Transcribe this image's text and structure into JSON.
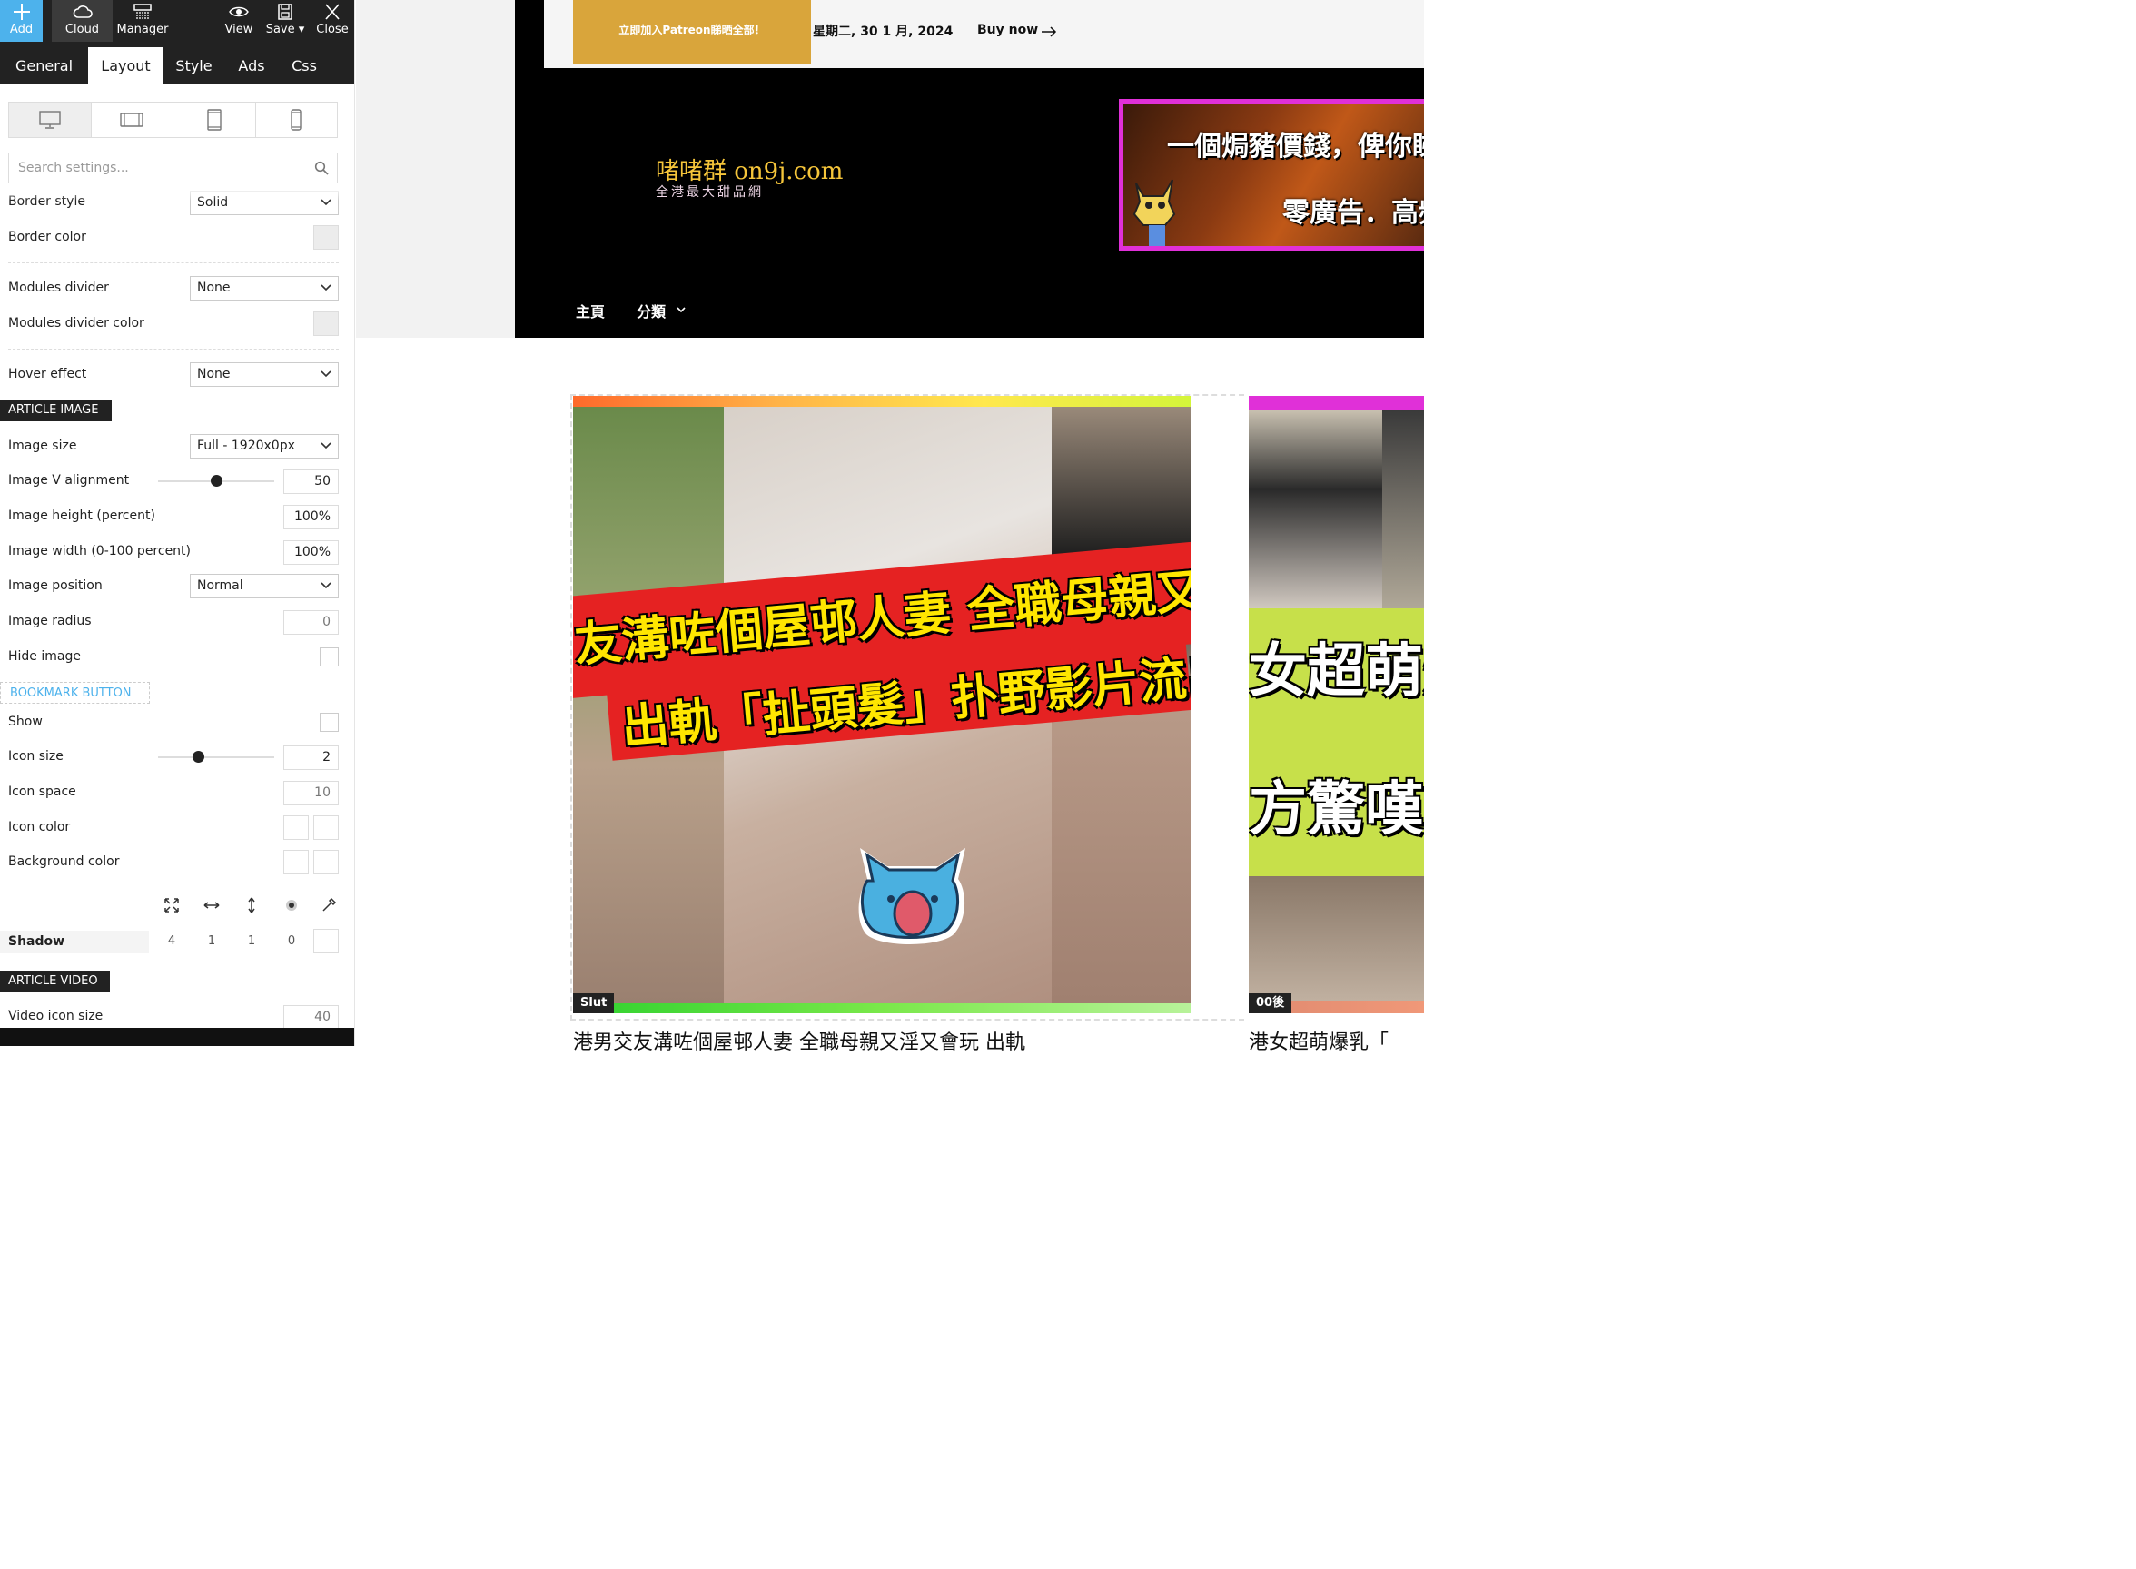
{
  "toolbar": {
    "add": "Add",
    "cloud": "Cloud",
    "manager": "Manager",
    "view": "View",
    "save": "Save",
    "close": "Close"
  },
  "tabs": [
    "General",
    "Layout",
    "Style",
    "Ads",
    "Css"
  ],
  "active_tab": "Layout",
  "search": {
    "placeholder": "Search settings..."
  },
  "settings": {
    "border_style": {
      "label": "Border style",
      "value": "Solid"
    },
    "border_color": {
      "label": "Border color"
    },
    "modules_divider": {
      "label": "Modules divider",
      "value": "None"
    },
    "modules_divider_color": {
      "label": "Modules divider color"
    },
    "hover_effect": {
      "label": "Hover effect",
      "value": "None"
    },
    "article_image_section": "ARTICLE IMAGE",
    "image_size": {
      "label": "Image size",
      "value": "Full - 1920x0px"
    },
    "image_v_alignment": {
      "label": "Image V alignment",
      "value": "50",
      "slider_fraction": 0.5
    },
    "image_height": {
      "label": "Image height (percent)",
      "value": "100%"
    },
    "image_width": {
      "label": "Image width (0-100 percent)",
      "value": "100%"
    },
    "image_position": {
      "label": "Image position",
      "value": "Normal"
    },
    "image_radius": {
      "label": "Image radius",
      "value": "0"
    },
    "hide_image": {
      "label": "Hide image"
    },
    "bookmark_section": "BOOKMARK BUTTON",
    "show": {
      "label": "Show"
    },
    "icon_size": {
      "label": "Icon size",
      "value": "2",
      "slider_fraction": 0.35
    },
    "icon_space": {
      "label": "Icon space",
      "value": "10"
    },
    "icon_color": {
      "label": "Icon color"
    },
    "background_color": {
      "label": "Background color"
    },
    "shadow": {
      "label": "Shadow",
      "values": [
        "4",
        "1",
        "1",
        "0"
      ]
    },
    "article_video_section": "ARTICLE VIDEO",
    "video_icon_size": {
      "label": "Video icon size",
      "value": "40"
    }
  },
  "site": {
    "patreon_cta": "立即加入Patreon睇晒全部！",
    "date": "星期二, 30 1 月, 2024",
    "buy_now": "Buy now",
    "logo_title": "啫啫群 on9j.com",
    "logo_subtitle": "全港最大甜品網",
    "banner_line1": "一個焗豬價錢，俾你睇晒香",
    "banner_line2": "零廣告．高頻",
    "nav": [
      "主頁",
      "分類"
    ]
  },
  "cards": [
    {
      "caption_line1": "友溝咗個屋邨人妻 全職母親又淫",
      "caption_line2": "出軌「扯頭髮」扑野影片流出",
      "tag": "Slut",
      "title": "港男交友溝咗個屋邨人妻 全職母親又淫又會玩 出軌"
    },
    {
      "caption_line1": "女超萌爆",
      "caption_line2": "方驚嘆：",
      "tag": "00後",
      "title": "港女超萌爆乳「"
    }
  ],
  "colors": {
    "accent": "#4db2ec",
    "toolbar_bg": "#222222",
    "patreon_gold": "#d9a53b",
    "logo_gold": "#f5c53a",
    "banner_border": "#e030d8"
  }
}
